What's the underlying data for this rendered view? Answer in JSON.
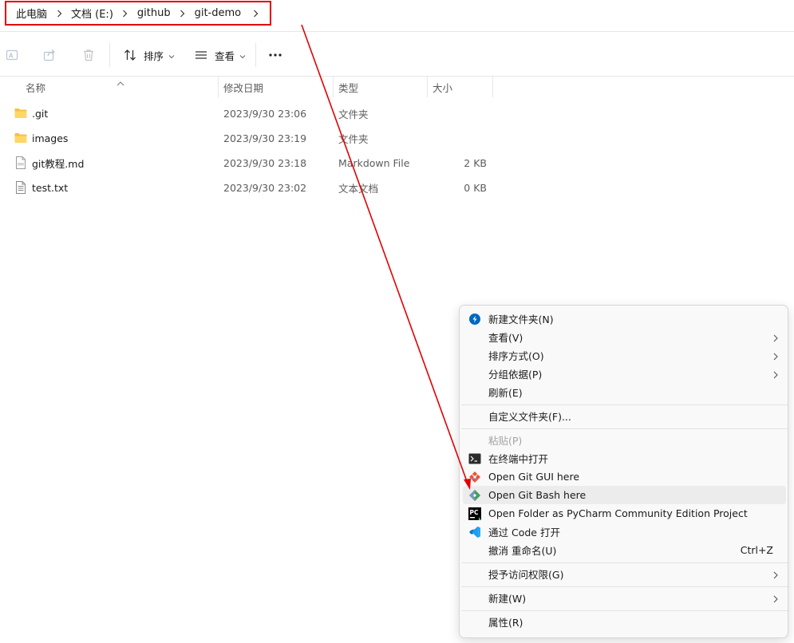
{
  "breadcrumb": {
    "items": [
      "此电脑",
      "文档 (E:)",
      "github",
      "git-demo"
    ]
  },
  "toolbar": {
    "sort_label": "排序",
    "view_label": "查看"
  },
  "columns": {
    "name": "名称",
    "date": "修改日期",
    "type": "类型",
    "size": "大小"
  },
  "files": [
    {
      "name": ".git",
      "date": "2023/9/30 23:06",
      "type": "文件夹",
      "size": "",
      "icon": "folder-icon"
    },
    {
      "name": "images",
      "date": "2023/9/30 23:19",
      "type": "文件夹",
      "size": "",
      "icon": "folder-icon"
    },
    {
      "name": "git教程.md",
      "date": "2023/9/30 23:18",
      "type": "Markdown File",
      "size": "2 KB",
      "icon": "markdown-file-icon"
    },
    {
      "name": "test.txt",
      "date": "2023/9/30 23:02",
      "type": "文本文档",
      "size": "0 KB",
      "icon": "text-file-icon"
    }
  ],
  "context_menu": {
    "new_folder": "新建文件夹(N)",
    "view": "查看(V)",
    "sort_by": "排序方式(O)",
    "group_by": "分组依据(P)",
    "refresh": "刷新(E)",
    "customize": "自定义文件夹(F)...",
    "paste": "粘贴(P)",
    "open_terminal": "在终端中打开",
    "git_gui": "Open Git GUI here",
    "git_bash": "Open Git Bash here",
    "pycharm": "Open Folder as PyCharm Community Edition Project",
    "vscode": "通过 Code 打开",
    "undo_rename": "撤消 重命名(U)",
    "undo_shortcut": "Ctrl+Z",
    "grant_access": "授予访问权限(G)",
    "new": "新建(W)",
    "properties": "属性(R)"
  },
  "colors": {
    "annotation": "#e30000",
    "folder": "#f4c045",
    "accent": "#0067c0",
    "git": "#f05133",
    "vscode": "#23a9f2"
  }
}
